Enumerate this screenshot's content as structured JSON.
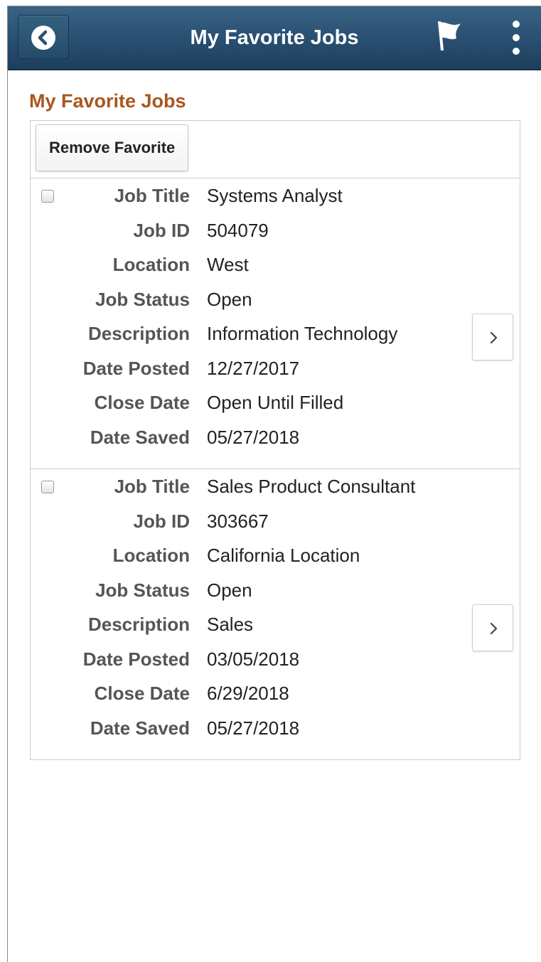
{
  "header": {
    "title": "My Favorite Jobs",
    "back_icon": "chevron-left-icon",
    "flag_icon": "flag-icon",
    "menu_icon": "more-vertical-icon",
    "background_color": "#2b5274"
  },
  "page": {
    "heading": "My Favorite Jobs",
    "heading_color": "#a9561e"
  },
  "toolbar": {
    "remove_label": "Remove Favorite"
  },
  "labels": {
    "job_title": "Job Title",
    "job_id": "Job ID",
    "location": "Location",
    "job_status": "Job Status",
    "description": "Description",
    "date_posted": "Date Posted",
    "close_date": "Close Date",
    "date_saved": "Date Saved"
  },
  "jobs": [
    {
      "selected": false,
      "job_title": "Systems Analyst",
      "job_id": "504079",
      "location": "West",
      "job_status": "Open",
      "description": "Information Technology",
      "date_posted": "12/27/2017",
      "close_date": "Open Until Filled",
      "date_saved": "05/27/2018"
    },
    {
      "selected": false,
      "job_title": "Sales Product Consultant",
      "job_id": "303667",
      "location": "California Location",
      "job_status": "Open",
      "description": "Sales",
      "date_posted": "03/05/2018",
      "close_date": "6/29/2018",
      "date_saved": "05/27/2018"
    }
  ]
}
